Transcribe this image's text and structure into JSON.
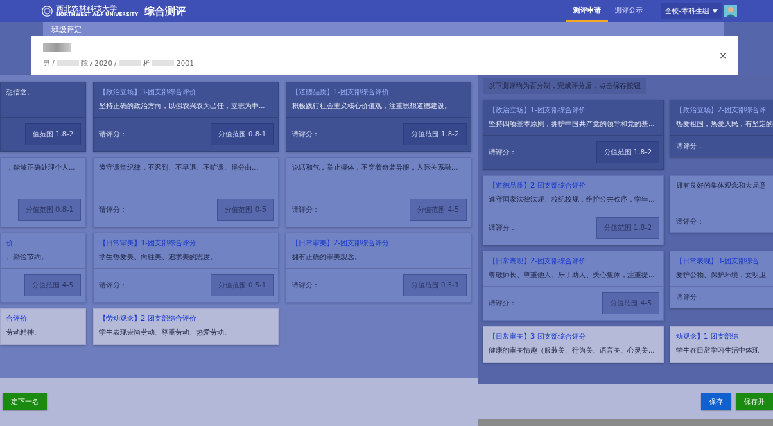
{
  "header": {
    "school": "西北农林科技大学",
    "school_en": "NORTHWEST A&F UNIVERSITY",
    "title": "综合测评",
    "nav": [
      {
        "label": "测评申请",
        "selected": true
      },
      {
        "label": "测评公示",
        "selected": false
      }
    ],
    "group": "全校-本科生组",
    "dropdown": "▼"
  },
  "subheader": "班级评定",
  "student": {
    "info": [
      {
        "kind": "text",
        "text": "男 /"
      },
      {
        "kind": "blur"
      },
      {
        "kind": "text",
        "text": "院 / 2020 /"
      },
      {
        "kind": "blur"
      },
      {
        "kind": "text",
        "text": "析"
      },
      {
        "kind": "blur"
      },
      {
        "kind": "text",
        "text": "2001"
      }
    ],
    "close": "×"
  },
  "left": {
    "cards": [
      {
        "desc": "想信念。",
        "range": "值范围 1.8-2"
      },
      {
        "title": "【政治立场】3-团支部综合评价",
        "desc": "坚持正确的政治方向，以强农兴农为己任，立志为中...",
        "prompt": "请评分：",
        "range": "分值范围 0.8-1"
      },
      {
        "title": "【道德品质】1-团支部综合评价",
        "desc": "积极践行社会主义核心价值观，注重思想道德建设。",
        "prompt": "请评分：",
        "range": "分值范围 1.8-2"
      },
      {
        "desc": "，能够正确处理个人...",
        "range": "分值范围 0.8-1"
      },
      {
        "desc": "遵守课堂纪律，不迟到、不早退、不旷课。得分由...",
        "prompt": "请评分：",
        "range": "分值范围 0-5"
      },
      {
        "desc": "说话和气，举止得体，不穿着奇装异服，人际关系融...",
        "prompt": "请评分：",
        "range": "分值范围 4-5"
      },
      {
        "title": "价",
        "desc": "、勤俭节约。",
        "range": "分值范围 4-5"
      },
      {
        "title": "【日常审美】1-团支部综合评分",
        "desc": "学生热爱美、向往美、追求美的志度。",
        "prompt": "请评分：",
        "range": "分值范围 0.5-1"
      },
      {
        "title": "【日常审美】2-团支部综合评分",
        "desc": "拥有正确的审美观念。",
        "prompt": "请评分：",
        "range": "分值范围 0.5-1"
      },
      {
        "title": "合评价",
        "desc": "劳动精神。"
      },
      {
        "title": "【劳动观念】2-团支部综合评价",
        "desc": "学生表现崇尚劳动、尊重劳动、热爱劳动。"
      }
    ],
    "next_button": "定下一名"
  },
  "right": {
    "note": "以下测评均为百分制，完成评分后，点击保存按钮",
    "cards": [
      {
        "title": "【政治立场】1-团支部综合评价",
        "desc": "坚持四项基本原则，拥护中国共产党的领导和党的基...",
        "prompt": "请评分：",
        "range": "分值范围 1.8-2"
      },
      {
        "title": "【政治立场】2-团支部综合评",
        "desc": "热爱祖国，热爱人民，有坚定的",
        "prompt": "请评分："
      },
      {
        "title": "【道德品质】2-团支部综合评价",
        "desc": "遵守国家法律法规、校纪校规，维护公共秩序，学年...",
        "prompt": "请评分：",
        "range": "分值范围 1.8-2"
      },
      {
        "desc": "拥有良好的集体观念和大局意",
        "prompt": "请评分："
      },
      {
        "title": "【日常表现】2-团支部综合评价",
        "desc": "尊敬师长、尊重他人、乐于助人、关心集体，注重提...",
        "prompt": "请评分：",
        "range": "分值范围 4-5"
      },
      {
        "title": "【日常表现】3-团支部综合",
        "desc": "爱护公物、保护环境，文明卫",
        "prompt": "请评分："
      },
      {
        "title": "【日常审美】3-团支部综合评分",
        "desc": "健康的审美情趣（服装美、行为美、语言美、心灵美..."
      },
      {
        "title": "动观念】1-团支部综",
        "desc": "学生在日常学习生活中体现"
      }
    ],
    "buttons": [
      {
        "label": "保存",
        "kind": "primary"
      },
      {
        "label": "保存并",
        "kind": "success"
      }
    ]
  }
}
